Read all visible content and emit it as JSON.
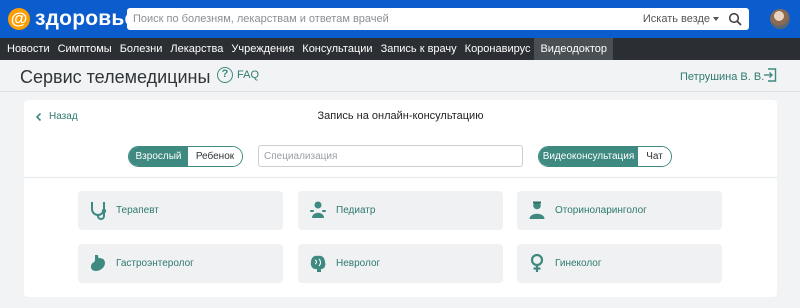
{
  "header": {
    "logo_mark": "@",
    "logo_text": "здоровье",
    "search_placeholder": "Поиск по болезням, лекарствам и ответам врачей",
    "search_scope": "Искать везде"
  },
  "nav": {
    "items": [
      "Новости",
      "Симптомы",
      "Болезни",
      "Лекарства",
      "Учреждения",
      "Консультации",
      "Запись к врачу",
      "Коронавирус",
      "Видеодоктор"
    ],
    "active_index": 8
  },
  "service": {
    "title": "Сервис телемедицины",
    "faq_label": "FAQ",
    "faq_icon_char": "?",
    "user_name": "Петрушина В. В."
  },
  "card": {
    "back_label": "Назад",
    "title": "Запись на онлайн-консультацию",
    "age_options": [
      "Взрослый",
      "Ребенок"
    ],
    "age_selected": 0,
    "specialization_placeholder": "Специализация",
    "mode_options": [
      "Видеоконсультация",
      "Чат"
    ],
    "mode_selected": 0
  },
  "specialists": [
    {
      "label": "Терапевт",
      "icon": "stethoscope-icon"
    },
    {
      "label": "Педиатр",
      "icon": "baby-icon"
    },
    {
      "label": "Оториноларинголог",
      "icon": "doctor-icon"
    },
    {
      "label": "Гастроэнтеролог",
      "icon": "stomach-icon"
    },
    {
      "label": "Невролог",
      "icon": "brain-icon"
    },
    {
      "label": "Гинеколог",
      "icon": "female-icon"
    }
  ],
  "colors": {
    "brand_blue": "#0b5ccc",
    "accent_teal": "#3e8a80",
    "nav_bg": "#2b2f33",
    "logo_orange": "#ff9e00"
  }
}
